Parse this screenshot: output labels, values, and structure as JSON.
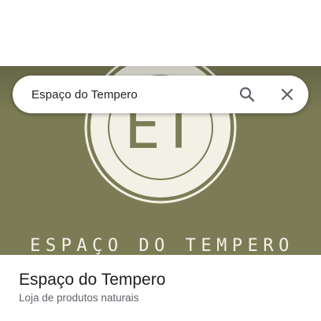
{
  "search": {
    "query": "Espaço do Tempero"
  },
  "hero": {
    "monogram": "ET",
    "caption": "ESPAÇO DO TEMPERO",
    "background_color": "#7b7c55",
    "foreground_color": "#f3f1e6"
  },
  "place": {
    "title": "Espaço do Tempero",
    "category": "Loja de produtos naturais"
  },
  "icons": {
    "search": "search-icon",
    "close": "close-icon"
  }
}
